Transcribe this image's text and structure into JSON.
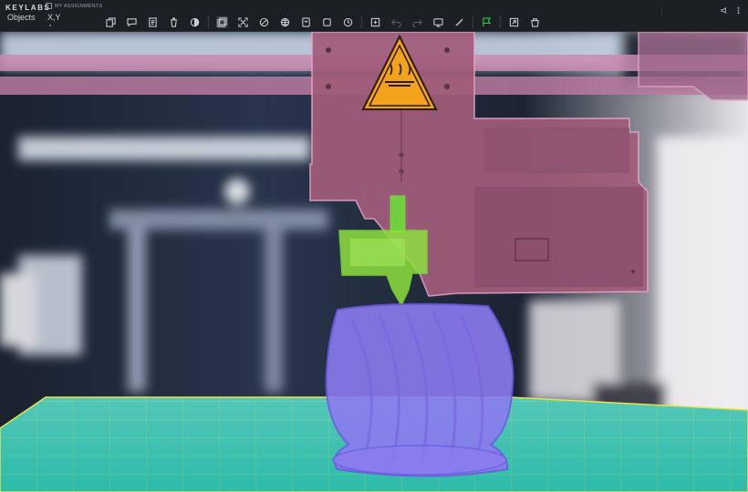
{
  "app": {
    "brand": "KEYLABS",
    "assignments_label": "MY ASSIGNMENTS"
  },
  "tabs": [
    {
      "label": "Objects"
    },
    {
      "label": "X,Y"
    }
  ],
  "toolbar": {
    "icons": [
      "copy-frame-icon",
      "comment-icon",
      "notes-icon",
      "cup-icon",
      "contrast-icon",
      "layers-icon",
      "fit-screen-icon",
      "shapes-icon",
      "grid-icon",
      "bookmark-icon",
      "frame-icon",
      "clock-icon",
      "add-point-icon",
      "undo-icon",
      "redo-icon",
      "ai-assist-icon",
      "ruler-icon",
      "flag-icon",
      "export-icon",
      "bag-icon"
    ]
  },
  "topright": {
    "icons": [
      "volume-icon",
      "more-icon"
    ]
  },
  "annotations": [
    {
      "label": "extruder-head",
      "color": "#e6a3c9"
    },
    {
      "label": "hotend",
      "color": "#7cdd3a"
    },
    {
      "label": "printed-vase",
      "color": "#8b7bf0"
    },
    {
      "label": "build-plate",
      "color": "#e6e34a"
    },
    {
      "label": "frame-rail",
      "color": "#e6a3c9"
    }
  ],
  "colors": {
    "warning": "#f2a31b",
    "flag": "#39c54a",
    "plate": "#2fc9b7"
  }
}
